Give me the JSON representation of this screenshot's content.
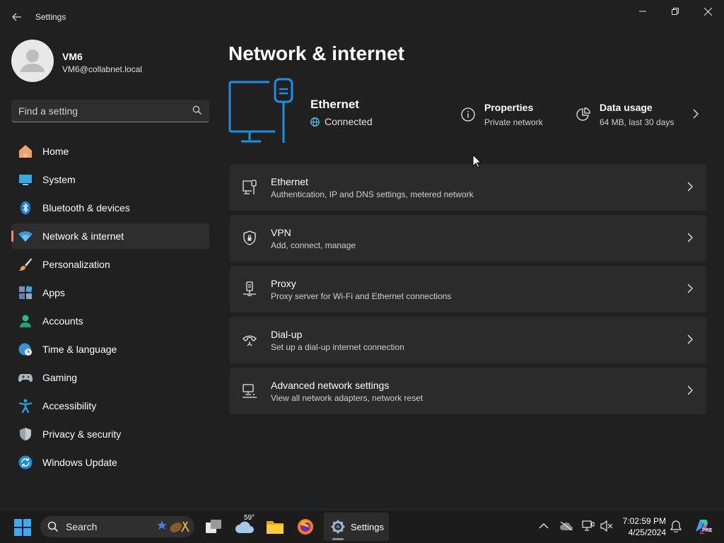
{
  "window": {
    "title": "Settings"
  },
  "profile": {
    "name": "VM6",
    "email": "VM6@collabnet.local"
  },
  "search": {
    "placeholder": "Find a setting"
  },
  "nav": {
    "items": [
      {
        "label": "Home",
        "icon": "home-icon"
      },
      {
        "label": "System",
        "icon": "system-icon"
      },
      {
        "label": "Bluetooth & devices",
        "icon": "bluetooth-icon"
      },
      {
        "label": "Network & internet",
        "icon": "wifi-icon",
        "active": true
      },
      {
        "label": "Personalization",
        "icon": "brush-icon"
      },
      {
        "label": "Apps",
        "icon": "apps-icon"
      },
      {
        "label": "Accounts",
        "icon": "accounts-icon"
      },
      {
        "label": "Time & language",
        "icon": "globe-clock-icon"
      },
      {
        "label": "Gaming",
        "icon": "gamepad-icon"
      },
      {
        "label": "Accessibility",
        "icon": "accessibility-icon"
      },
      {
        "label": "Privacy & security",
        "icon": "shield-icon"
      },
      {
        "label": "Windows Update",
        "icon": "update-icon"
      }
    ]
  },
  "main": {
    "title": "Network & internet",
    "hero": {
      "name": "Ethernet",
      "status": "Connected",
      "properties": {
        "title": "Properties",
        "sub": "Private network"
      },
      "data_usage": {
        "title": "Data usage",
        "sub": "64 MB, last 30 days"
      }
    },
    "cards": [
      {
        "title": "Ethernet",
        "sub": "Authentication, IP and DNS settings, metered network",
        "icon": "ethernet-icon"
      },
      {
        "title": "VPN",
        "sub": "Add, connect, manage",
        "icon": "vpn-shield-icon"
      },
      {
        "title": "Proxy",
        "sub": "Proxy server for Wi-Fi and Ethernet connections",
        "icon": "proxy-icon"
      },
      {
        "title": "Dial-up",
        "sub": "Set up a dial-up internet connection",
        "icon": "dialup-icon"
      },
      {
        "title": "Advanced network settings",
        "sub": "View all network adapters, network reset",
        "icon": "advanced-network-icon"
      }
    ]
  },
  "taskbar": {
    "search_label": "Search",
    "weather_temp": "59°",
    "settings_label": "Settings",
    "time": "7:02:59 PM",
    "date": "4/25/2024",
    "copilot_badge": "PRE"
  },
  "colors": {
    "accent": "#60cdff",
    "active_indicator": "#f08a6c",
    "background": "#202020",
    "card": "#2b2b2b"
  }
}
